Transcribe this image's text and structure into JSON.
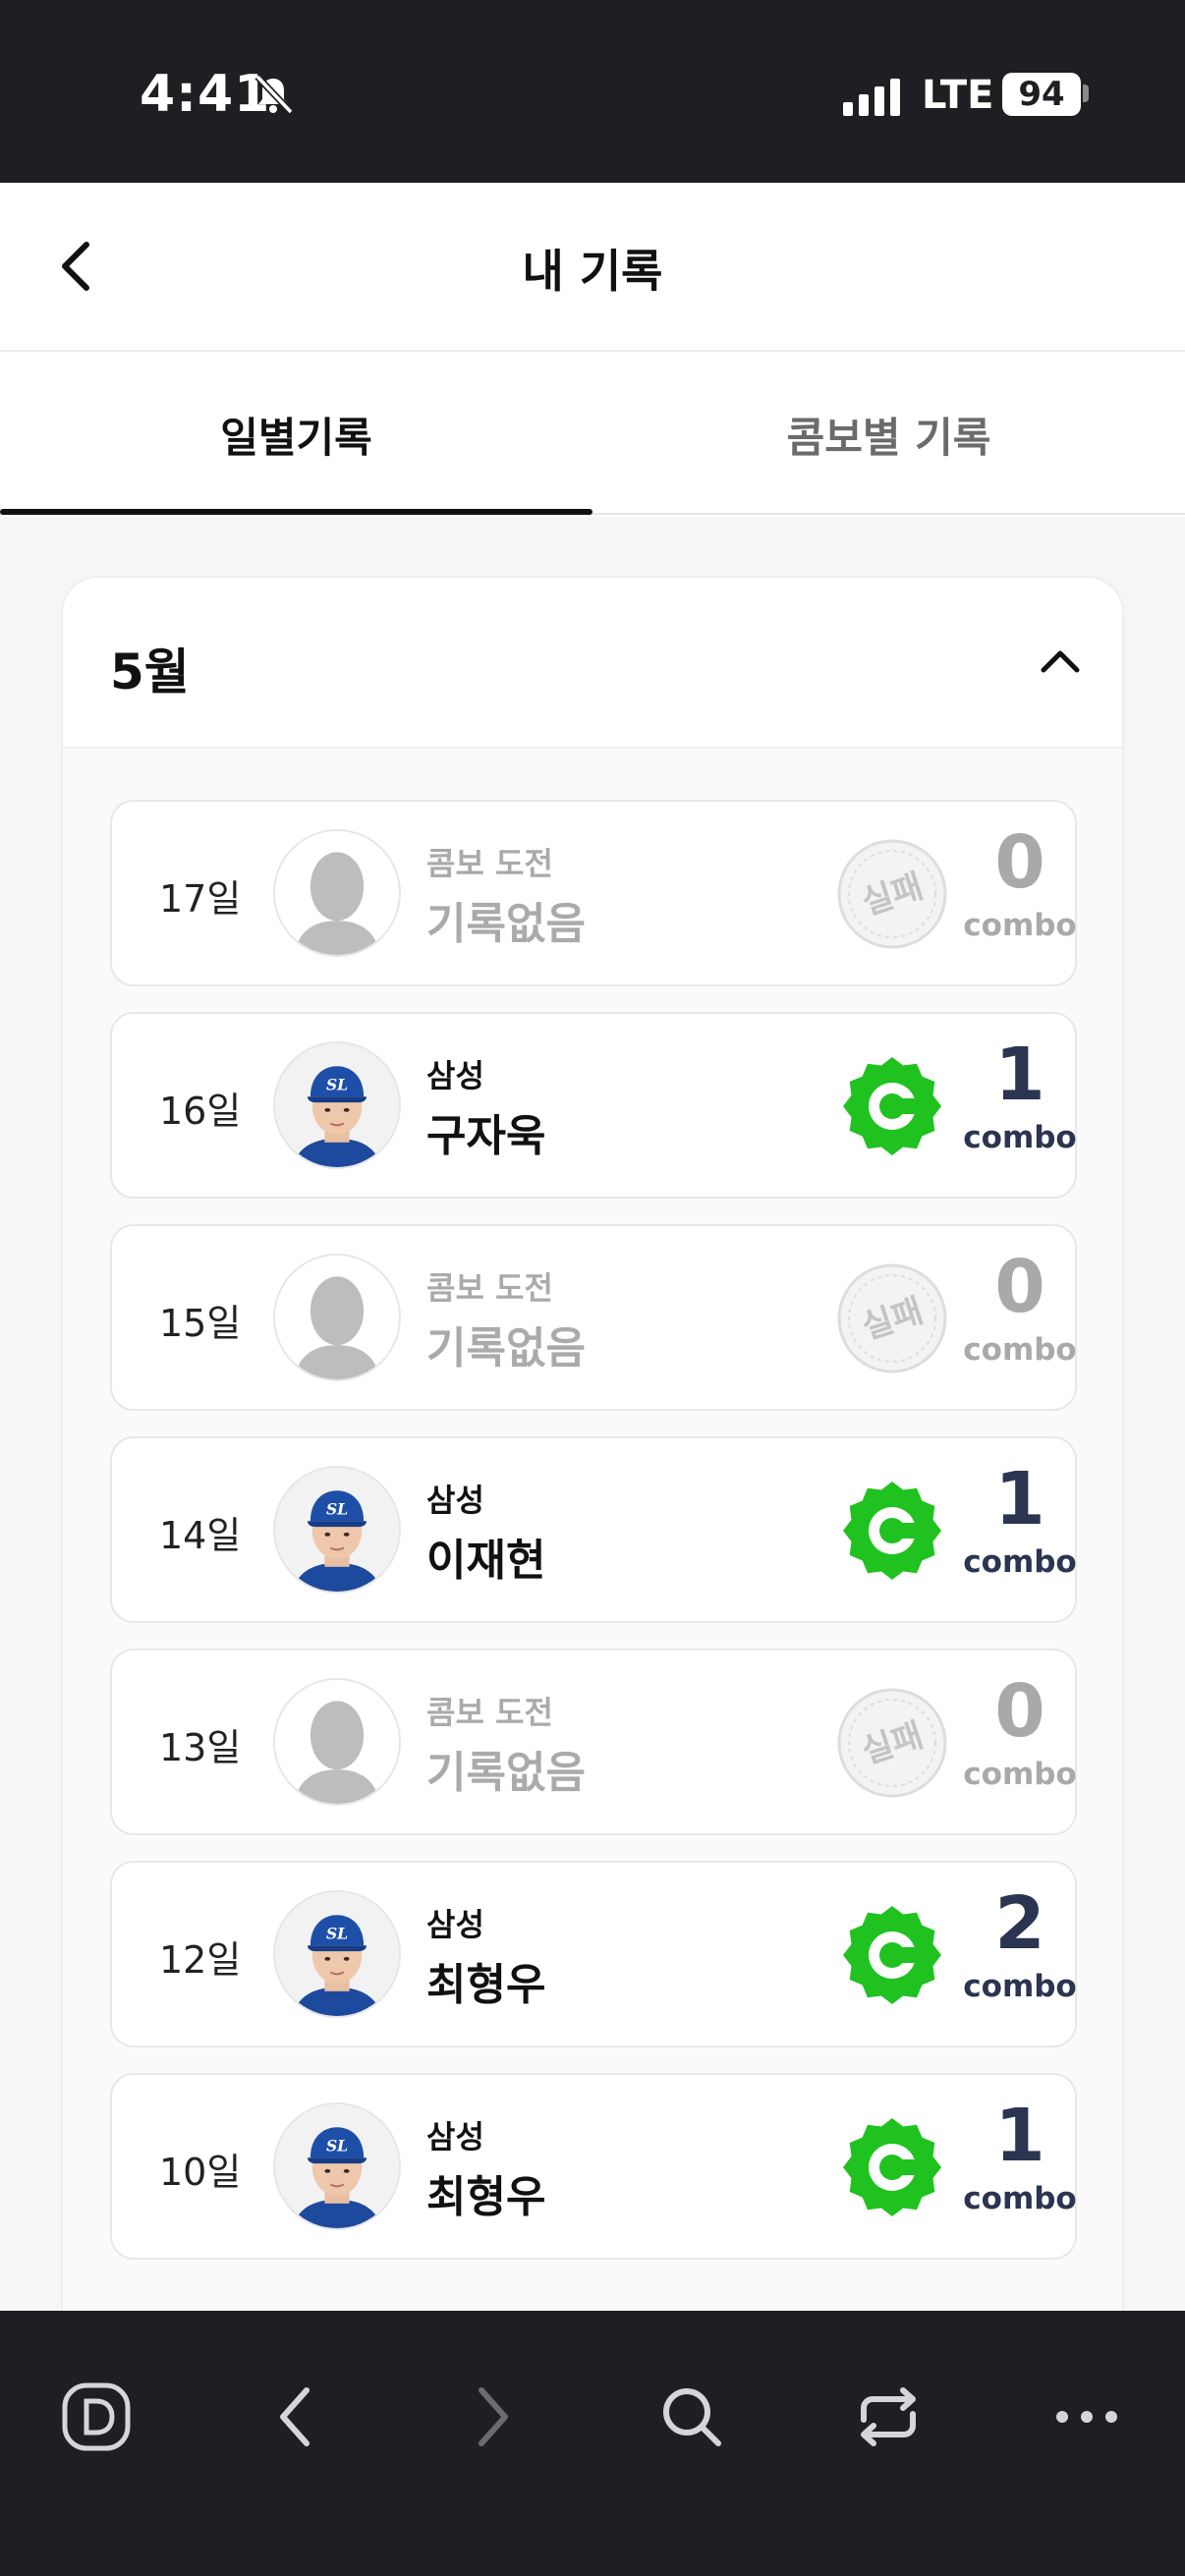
{
  "status_bar": {
    "time": "4:41",
    "network": "LTE",
    "battery": "94"
  },
  "header": {
    "title": "내 기록"
  },
  "tabs": [
    {
      "label": "일별기록",
      "active": true
    },
    {
      "label": "콤보별 기록",
      "active": false
    }
  ],
  "month": {
    "label": "5월",
    "expanded": true
  },
  "records": [
    {
      "day": "17일",
      "sub": "콤보 도전",
      "main": "기록없음",
      "status": "fail",
      "badge_text": "실패",
      "combo": "0",
      "combo_label": "combo"
    },
    {
      "day": "16일",
      "sub": "삼성",
      "main": "구자욱",
      "status": "success",
      "badge_text": "C",
      "combo": "1",
      "combo_label": "combo"
    },
    {
      "day": "15일",
      "sub": "콤보 도전",
      "main": "기록없음",
      "status": "fail",
      "badge_text": "실패",
      "combo": "0",
      "combo_label": "combo"
    },
    {
      "day": "14일",
      "sub": "삼성",
      "main": "이재현",
      "status": "success",
      "badge_text": "C",
      "combo": "1",
      "combo_label": "combo"
    },
    {
      "day": "13일",
      "sub": "콤보 도전",
      "main": "기록없음",
      "status": "fail",
      "badge_text": "실패",
      "combo": "0",
      "combo_label": "combo"
    },
    {
      "day": "12일",
      "sub": "삼성",
      "main": "최형우",
      "status": "success",
      "badge_text": "C",
      "combo": "2",
      "combo_label": "combo"
    },
    {
      "day": "10일",
      "sub": "삼성",
      "main": "최형우",
      "status": "success",
      "badge_text": "C",
      "combo": "1",
      "combo_label": "combo"
    }
  ],
  "team_cap_logo": "SL",
  "colors": {
    "success_green": "#1fc21f",
    "combo_navy": "#2b3450",
    "fail_gray": "#a9a9a9",
    "bar_dark": "#1f1f23"
  },
  "bottom_bar": {
    "icons": [
      "d-logo-icon",
      "back-arrow-icon",
      "forward-arrow-icon",
      "search-icon",
      "repeat-icon",
      "more-icon"
    ]
  }
}
